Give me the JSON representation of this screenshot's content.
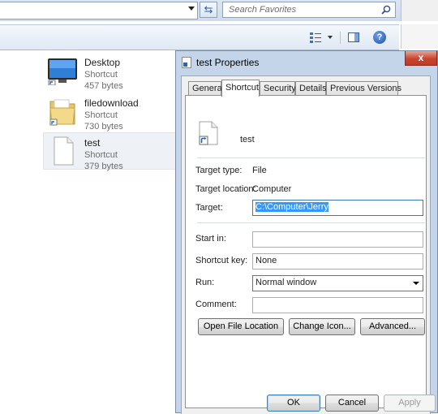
{
  "explorer": {
    "search_placeholder": "Search Favorites",
    "files": [
      {
        "name": "Desktop",
        "type": "Shortcut",
        "size": "457 bytes",
        "icon": "desktop-icon"
      },
      {
        "name": "filedownload",
        "type": "Shortcut",
        "size": "730 bytes",
        "icon": "folder-icon"
      },
      {
        "name": "test",
        "type": "Shortcut",
        "size": "379 bytes",
        "icon": "file-icon"
      }
    ]
  },
  "dialog": {
    "title": "test Properties",
    "close_label": "x",
    "tabs": [
      "General",
      "Shortcut",
      "Security",
      "Details",
      "Previous Versions"
    ],
    "active_tab": "Shortcut",
    "shortcut_name": "test",
    "target_type_label": "Target type:",
    "target_type_value": "File",
    "target_location_label": "Target location:",
    "target_location_value": "Computer",
    "target_label": "Target:",
    "target_value": "C:\\Computer\\Jerry",
    "start_in_label": "Start in:",
    "start_in_value": "",
    "shortcut_key_label": "Shortcut key:",
    "shortcut_key_value": "None",
    "run_label": "Run:",
    "run_value": "Normal window",
    "comment_label": "Comment:",
    "comment_value": "",
    "buttons": {
      "open_file_location": "Open File Location",
      "change_icon": "Change Icon...",
      "advanced": "Advanced...",
      "ok": "OK",
      "cancel": "Cancel",
      "apply": "Apply"
    }
  },
  "colors": {
    "selection": "#3399ff",
    "dialog_frame": "#c4d5ea",
    "close_button": "#c7452f"
  }
}
